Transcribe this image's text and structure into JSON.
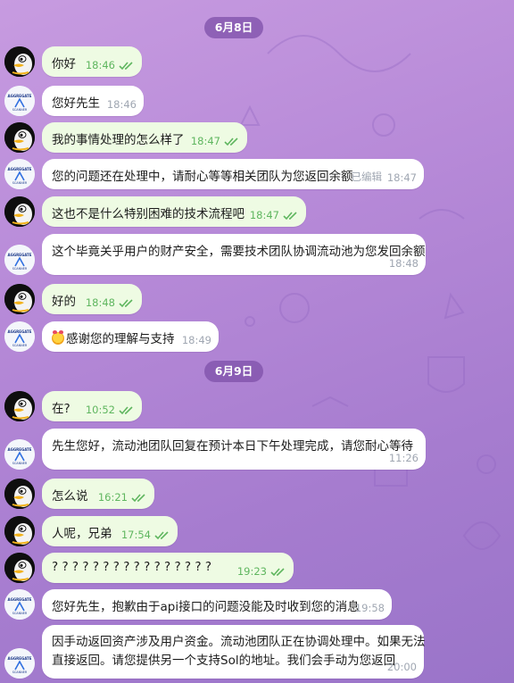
{
  "dates": {
    "d1": "6月8日",
    "d2": "6月9日"
  },
  "messages": [
    {
      "dir": "out",
      "text": "你好",
      "time": "18:46",
      "read": true
    },
    {
      "dir": "in",
      "text": "您好先生",
      "time": "18:46"
    },
    {
      "dir": "out",
      "text": "我的事情处理的怎么样了",
      "time": "18:47",
      "read": true
    },
    {
      "dir": "in",
      "text": "您的问题还在处理中，请耐心等等相关团队为您返回余额",
      "time": "18:47",
      "edited": "已编辑"
    },
    {
      "dir": "out",
      "text": "这也不是什么特别困难的技术流程吧",
      "time": "18:47",
      "read": true
    },
    {
      "dir": "in",
      "text": "这个毕竟关乎用户的财产安全，需要技术团队协调流动池为您发回余额",
      "time": "18:48"
    },
    {
      "dir": "out",
      "text": "好的",
      "time": "18:48",
      "read": true
    },
    {
      "dir": "in",
      "text": "感谢您的理解与支持",
      "time": "18:49",
      "emoji": "smiling-face-hearts-emoji"
    },
    {
      "dir": "out",
      "text": "在?",
      "time": "10:52",
      "read": true
    },
    {
      "dir": "in",
      "text": "先生您好，流动池团队回复在预计本日下午处理完成，请您耐心等待",
      "time": "11:26"
    },
    {
      "dir": "out",
      "text": "怎么说",
      "time": "16:21",
      "read": true
    },
    {
      "dir": "out",
      "text": "人呢，兄弟",
      "time": "17:54",
      "read": true
    },
    {
      "dir": "out",
      "text": "? ? ? ? ? ? ? ? ? ? ? ? ? ? ? ?",
      "time": "19:23",
      "read": true
    },
    {
      "dir": "in",
      "text": "您好先生，抱歉由于api接口的问题没能及时收到您的消息",
      "time": "19:58"
    },
    {
      "dir": "in",
      "text": "因手动返回资产涉及用户资金。流动池团队正在协调处理中。如果无法",
      "text2": "直接返回。请您提供另一个支持Sol的地址。我们会手动为您返回",
      "time": "20:00"
    }
  ],
  "colors": {
    "outgoing_bubble": "#eefbe3",
    "incoming_bubble": "#ffffff",
    "read_check": "#5fb65f",
    "date_pill": "#8052aa"
  },
  "icons": {
    "user_avatar": "penguin-avatar",
    "support_avatar": "support-logo-avatar",
    "read_receipt": "double-check-icon"
  }
}
